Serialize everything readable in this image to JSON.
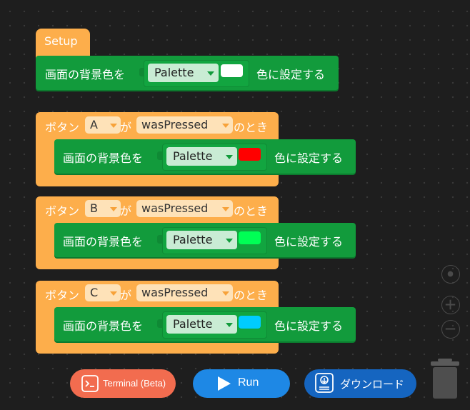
{
  "setup": {
    "hat_label": "Setup",
    "statement": {
      "label": "画面の背景色を",
      "dropdown": "Palette",
      "color": "#ffffff",
      "suffix": "色に設定する"
    }
  },
  "events": [
    {
      "prefix": "ボタン",
      "button": "A",
      "particle": "が",
      "event": "wasPressed",
      "suffix": "のとき",
      "statement": {
        "label": "画面の背景色を",
        "dropdown": "Palette",
        "color": "#ff0000",
        "suffix": "色に設定する"
      }
    },
    {
      "prefix": "ボタン",
      "button": "B",
      "particle": "が",
      "event": "wasPressed",
      "suffix": "のとき",
      "statement": {
        "label": "画面の背景色を",
        "dropdown": "Palette",
        "color": "#00ff55",
        "suffix": "色に設定する"
      }
    },
    {
      "prefix": "ボタン",
      "button": "C",
      "particle": "が",
      "event": "wasPressed",
      "suffix": "のとき",
      "statement": {
        "label": "画面の背景色を",
        "dropdown": "Palette",
        "color": "#00ccff",
        "suffix": "色に設定する"
      }
    }
  ],
  "toolbar": {
    "terminal_label": "Terminal (Beta)",
    "run_label": "Run",
    "download_label": "ダウンロード"
  },
  "colors": {
    "event_block": "#fdae4b",
    "action_block": "#129b3c",
    "terminal_button": "#f26c4f",
    "run_button": "#1e88e5",
    "download_button": "#1565c0"
  }
}
